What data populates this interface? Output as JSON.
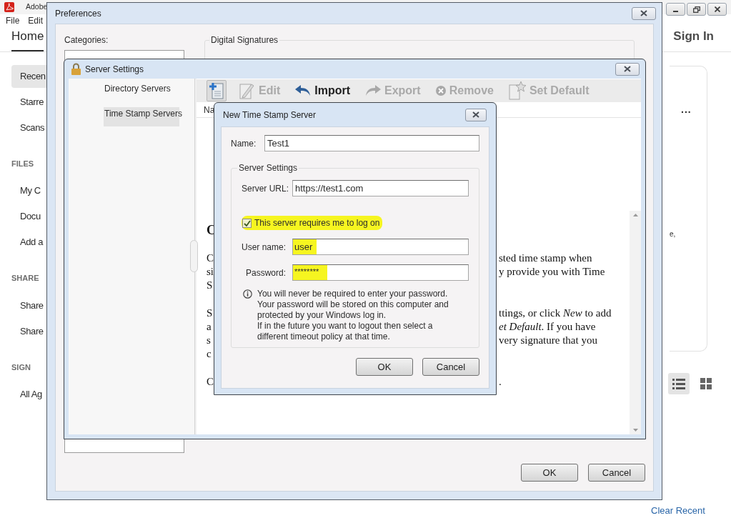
{
  "app": {
    "title": "Adobe",
    "menu": [
      "File",
      "Edit"
    ],
    "tabs": [
      {
        "label": "Home",
        "selected": true
      }
    ],
    "sign_in": "Sign In",
    "sidebar": [
      {
        "kind": "item",
        "label": "Recen",
        "selected": true
      },
      {
        "kind": "item",
        "label": "Starre",
        "selected": false
      },
      {
        "kind": "item",
        "label": "Scans",
        "selected": false
      },
      {
        "kind": "heading",
        "label": "FILES"
      },
      {
        "kind": "item",
        "label": "My C",
        "selected": false
      },
      {
        "kind": "item",
        "label": "Docu",
        "selected": false
      },
      {
        "kind": "item",
        "label": "Add a",
        "selected": false
      },
      {
        "kind": "heading",
        "label": "SHARE"
      },
      {
        "kind": "item",
        "label": "Share",
        "selected": false
      },
      {
        "kind": "item",
        "label": "Share",
        "selected": false
      },
      {
        "kind": "heading",
        "label": "SIGN"
      },
      {
        "kind": "item",
        "label": "All Ag",
        "selected": false
      }
    ],
    "card_more": "...",
    "card_fragment": "e,",
    "views": [
      {
        "kind": "list",
        "selected": true
      },
      {
        "kind": "grid",
        "selected": false
      }
    ],
    "clear_recent": "Clear Recent"
  },
  "preferences": {
    "title": "Preferences",
    "categories_label": "Categories:",
    "group_label": "Digital Signatures",
    "buttons": [
      "OK",
      "Cancel"
    ]
  },
  "server_settings": {
    "title": "Server Settings",
    "categories": [
      {
        "label": "Directory Servers",
        "selected": false
      },
      {
        "label": "Time Stamp Servers",
        "selected": true
      }
    ],
    "toolbar": [
      {
        "kind": "new",
        "disabled": false,
        "selected": true
      },
      {
        "kind": "edit",
        "label": "Edit",
        "disabled": true,
        "selected": false
      },
      {
        "kind": "import",
        "label": "Import",
        "disabled": false,
        "selected": false
      },
      {
        "kind": "export",
        "label": "Export",
        "disabled": true,
        "selected": false
      },
      {
        "kind": "remove",
        "label": "Remove",
        "disabled": true,
        "selected": false
      },
      {
        "kind": "default",
        "label": "Set Default",
        "disabled": true,
        "selected": false
      }
    ],
    "column_1": "Na",
    "help": [
      {
        "kind": "heading",
        "lines": [
          {
            "left": "C"
          }
        ]
      },
      {
        "kind": "body",
        "lines": [
          {
            "left": "C",
            "right": "sted time stamp when"
          },
          {
            "left": "si",
            "right": "y provide you with Time"
          },
          {
            "left": "S"
          }
        ]
      },
      {
        "kind": "body",
        "lines": [
          {
            "left": "S",
            "right": "ttings, or click *New* to add"
          },
          {
            "left": "a",
            "right": "*et Default*. If you have"
          },
          {
            "left": "s",
            "right": "very signature that you"
          },
          {
            "left": "c"
          }
        ]
      },
      {
        "kind": "body",
        "lines": [
          {
            "left": "C",
            "right": "."
          }
        ]
      }
    ]
  },
  "new_server": {
    "title": "New Time Stamp Server",
    "name_label": "Name:",
    "name_value": "Test1",
    "group_label": "Server Settings",
    "url_label": "Server URL:",
    "url_value": "https://test1.com",
    "logon": {
      "label": "This server requires me to log on",
      "checked": true,
      "highlighted": true
    },
    "user_label": "User name:",
    "user_value": "user",
    "user_highlighted": true,
    "password_label": "Password:",
    "password_value": "********",
    "password_highlighted": true,
    "info": [
      "You will never be required to enter your password.",
      "Your password will be stored on this computer and",
      "protected by your Windows log in.",
      "If in the future you want to logout then select a",
      "different timeout policy at that time."
    ],
    "buttons": [
      "OK",
      "Cancel"
    ]
  }
}
